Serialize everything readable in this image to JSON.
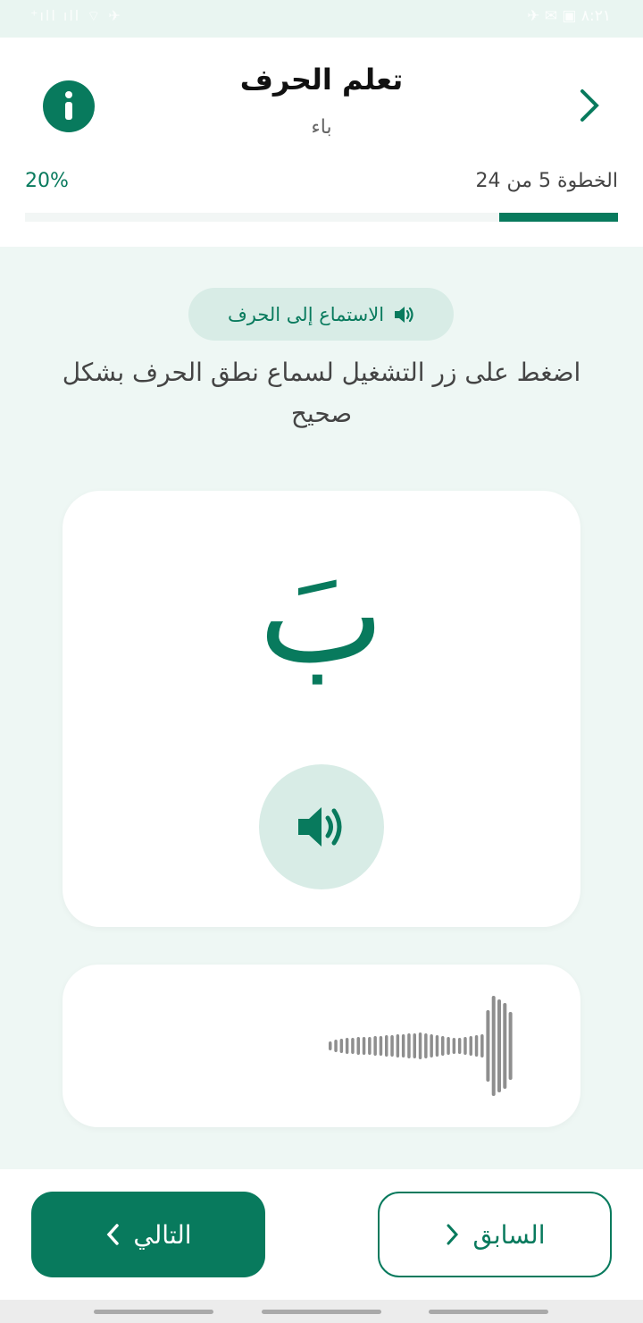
{
  "status_bar": {
    "left": "⁺ıll ıll ⌔ ✈",
    "right": "✈ ✉ ▣ ٨:٢١"
  },
  "header": {
    "title": "تعلم الحرف",
    "subtitle": "باء",
    "step_text": "الخطوة 5 من 24",
    "percent_text": "20%",
    "progress": 0.2
  },
  "lesson": {
    "listen_label": "الاستماع إلى الحرف",
    "instructions": "اضغط على زر التشغيل لسماع نطق الحرف بشكل صحيح",
    "letter": "بَ"
  },
  "footer": {
    "next_label": "التالي",
    "prev_label": "السابق"
  },
  "colors": {
    "primary": "#087a5d",
    "chip": "#d8ece6",
    "background": "#eef7f4"
  },
  "icons": {
    "info": "info-icon",
    "back": "chevron-right-icon",
    "speaker": "speaker-icon",
    "next": "chevron-left-icon",
    "prev": "chevron-right-icon"
  }
}
